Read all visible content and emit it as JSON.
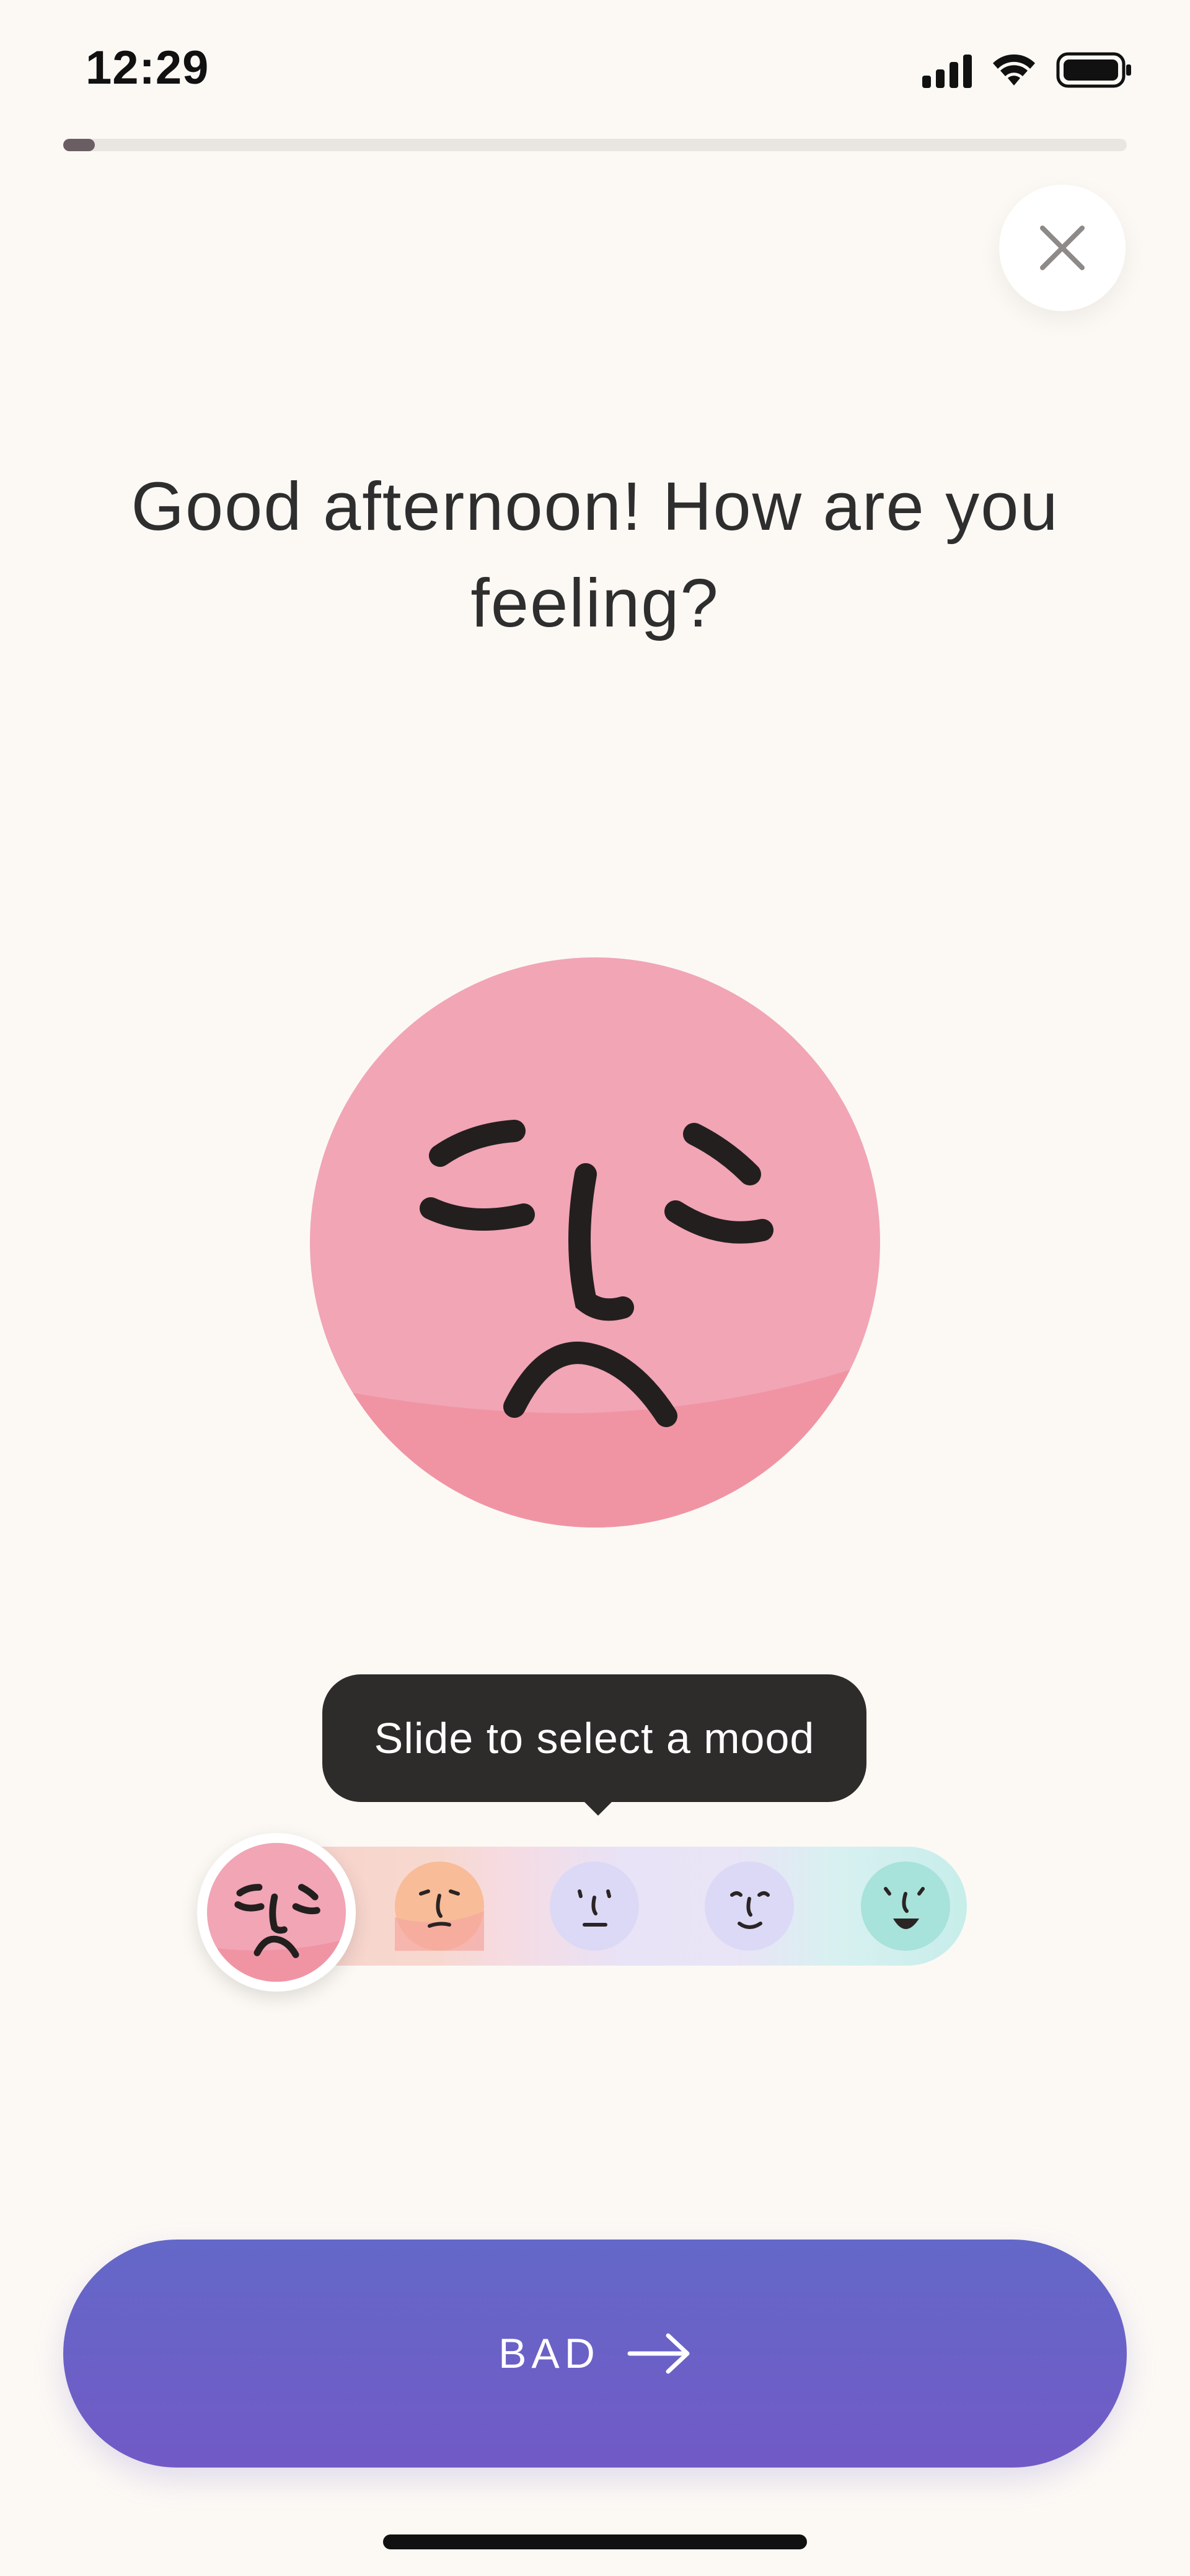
{
  "status_bar": {
    "time": "12:29",
    "icons": [
      "signal-icon",
      "wifi-icon",
      "battery-icon"
    ]
  },
  "progress": {
    "fraction": 0.03
  },
  "close_button": {
    "icon": "close-icon"
  },
  "greeting": "Good afternoon! How are you feeling?",
  "mood_selector": {
    "tooltip": "Slide to select a mood",
    "selected_index": 0,
    "selected_color": "#F1A3B4",
    "moods": [
      {
        "icon": "sad-face-icon",
        "color": "#F1A3B4"
      },
      {
        "icon": "meh-face-icon",
        "color": "#F8BC99"
      },
      {
        "icon": "neutral-face-icon",
        "color": "#DCD9F6"
      },
      {
        "icon": "content-face-icon",
        "color": "#DCD9F6"
      },
      {
        "icon": "happy-face-icon",
        "color": "#A7E2DB"
      }
    ]
  },
  "cta": {
    "label": "BAD",
    "icon": "arrow-right-icon",
    "color": "#6A64C8"
  }
}
